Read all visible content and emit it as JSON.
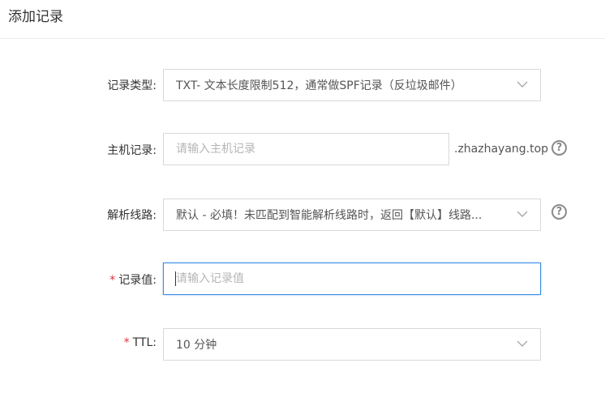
{
  "header": {
    "title": "添加记录"
  },
  "form": {
    "record_type": {
      "label": "记录类型:",
      "value": "TXT- 文本长度限制512，通常做SPF记录（反垃圾邮件）"
    },
    "host_record": {
      "label": "主机记录:",
      "placeholder": "请输入主机记录",
      "suffix": ".zhazhayang.top",
      "help": "?"
    },
    "line": {
      "label": "解析线路:",
      "value": "默认 - 必填！未匹配到智能解析线路时，返回【默认】线路...",
      "help": "?"
    },
    "record_value": {
      "required_mark": "*",
      "label": "记录值:",
      "placeholder": "请输入记录值"
    },
    "ttl": {
      "required_mark": "*",
      "label": "TTL:",
      "value": "10 分钟"
    }
  },
  "colors": {
    "required": "#d9343a",
    "focus_border": "#3c8ee6",
    "border": "#d9d9d9"
  }
}
